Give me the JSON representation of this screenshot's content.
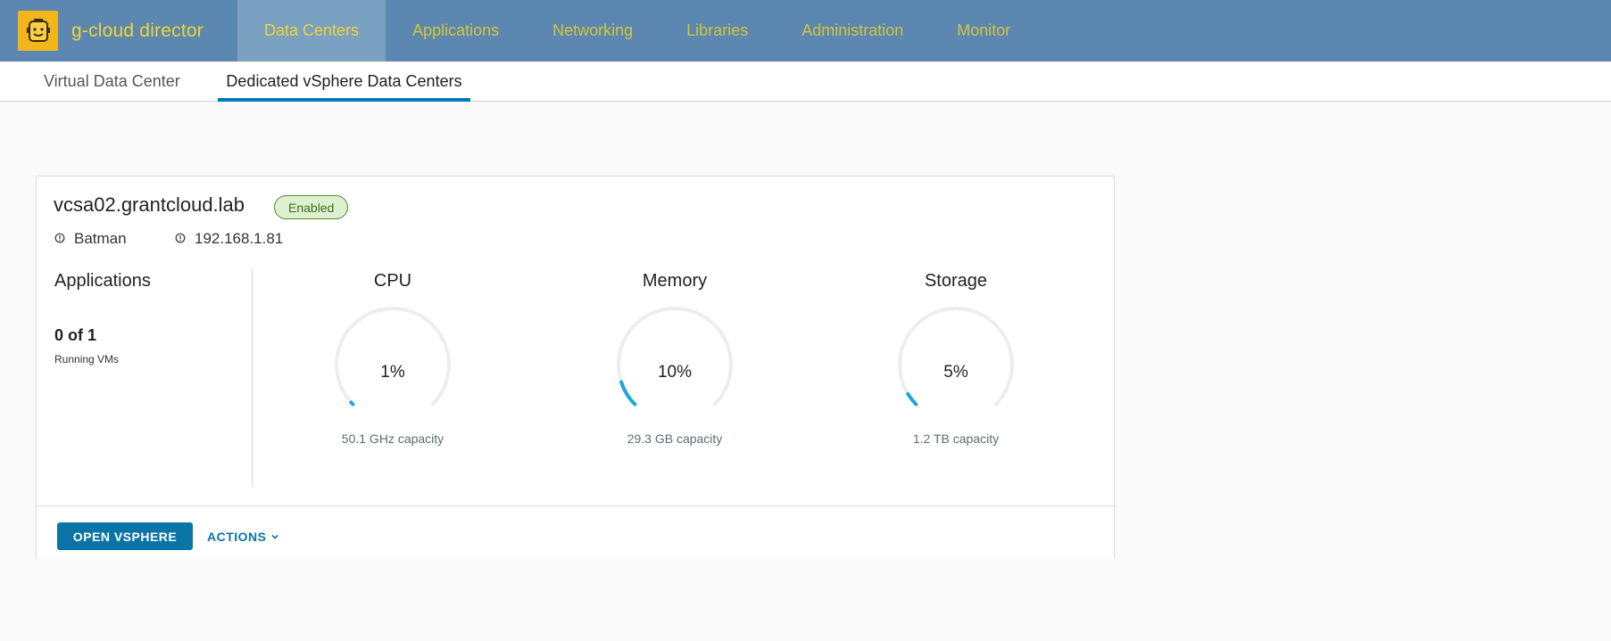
{
  "header": {
    "app_title": "g-cloud director",
    "logo_icon": "robot-face-icon",
    "nav": [
      {
        "label": "Data Centers",
        "active": true
      },
      {
        "label": "Applications",
        "active": false
      },
      {
        "label": "Networking",
        "active": false
      },
      {
        "label": "Libraries",
        "active": false
      },
      {
        "label": "Administration",
        "active": false
      },
      {
        "label": "Monitor",
        "active": false
      }
    ]
  },
  "subtabs": [
    {
      "label": "Virtual Data Center",
      "active": false
    },
    {
      "label": "Dedicated vSphere Data Centers",
      "active": true
    }
  ],
  "card": {
    "title": "vcsa02.grantcloud.lab",
    "status": "Enabled",
    "owner": "Batman",
    "address": "192.168.1.81",
    "applications": {
      "title": "Applications",
      "count": "0 of 1",
      "caption": "Running VMs"
    },
    "gauges": [
      {
        "title": "CPU",
        "value_label": "1%",
        "percent": 1,
        "capacity": "50.1 GHz capacity"
      },
      {
        "title": "Memory",
        "value_label": "10%",
        "percent": 10,
        "capacity": "29.3 GB capacity"
      },
      {
        "title": "Storage",
        "value_label": "5%",
        "percent": 5,
        "capacity": "1.2 TB capacity"
      }
    ],
    "footer": {
      "primary_label": "OPEN VSPHERE",
      "actions_label": "ACTIONS"
    }
  },
  "colors": {
    "header_bg": "#5b87b0",
    "nav_text": "#d4c53a",
    "accent": "#0a74a6",
    "gauge_fill": "#1aa9d6",
    "gauge_track": "#eeeeee",
    "badge_bg": "#dff0d0"
  }
}
